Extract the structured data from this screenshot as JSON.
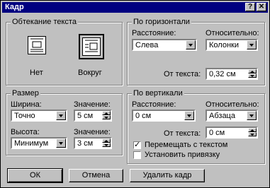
{
  "title": "Кадр",
  "title_buttons": {
    "help": "?",
    "close": "✕"
  },
  "wrap_group": {
    "label": "Обтекание текста",
    "none_label": "Нет",
    "around_label": "Вокруг"
  },
  "horizontal_group": {
    "label": "По горизонтали",
    "position_label": "Расстояние:",
    "position_value": "Слева",
    "relative_label": "Относительно:",
    "relative_value": "Колонки",
    "distance_label": "От текста:",
    "distance_value": "0,32 см"
  },
  "size_group": {
    "label": "Размер",
    "width_label": "Ширина:",
    "width_value": "Точно",
    "width_amount_label": "Значение:",
    "width_amount_value": "5 см",
    "height_label": "Высота:",
    "height_value": "Минимум",
    "height_amount_label": "Значение:",
    "height_amount_value": "3 см"
  },
  "vertical_group": {
    "label": "По вертикали",
    "position_label": "Расстояние:",
    "position_value": "0 см",
    "relative_label": "Относительно:",
    "relative_value": "Абзаца",
    "distance_label": "От текста:",
    "distance_value": "0 см",
    "move_with_text_label": "Перемещать с текстом",
    "move_with_text_checked": true,
    "lock_anchor_label": "Установить привязку",
    "lock_anchor_checked": false
  },
  "buttons": {
    "ok": "ОК",
    "cancel": "Отмена",
    "remove": "Удалить кадр"
  }
}
